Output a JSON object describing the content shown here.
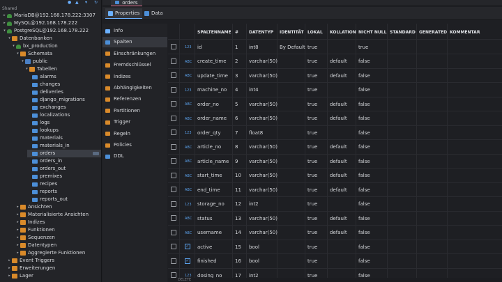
{
  "navigator": {
    "section_label": "Shared",
    "connections": [
      {
        "label": "MariaDB@192.168.178.222:3307"
      },
      {
        "label": "MySQL@192.168.178.222"
      },
      {
        "label": "PostgreSQL@192.168.178.222"
      }
    ],
    "tree": {
      "databases_label": "Datenbanken",
      "database_label": "bx_production",
      "schemata_label": "Schemata",
      "schema_label": "public",
      "tables_label": "Tabellen",
      "tables": [
        "alarms",
        "changes",
        "deliveries",
        "django_migrations",
        "exchanges",
        "localizations",
        "logs",
        "lookups",
        "materials",
        "materials_in",
        "orders",
        "orders_in",
        "orders_out",
        "premixes",
        "recipes",
        "reports",
        "reports_out"
      ],
      "selected_table": "orders",
      "schema_folders": [
        "Ansichten",
        "Materialisierte Ansichten",
        "Indizes",
        "Funktionen",
        "Sequenzen",
        "Datentypen",
        "Aggregierte Funktionen"
      ],
      "db_folders": [
        "Event Triggers",
        "Erweiterungen",
        "Lager"
      ]
    }
  },
  "editor": {
    "tab_label": "orders",
    "subtabs": [
      {
        "label": "Properties"
      },
      {
        "label": "Data"
      }
    ],
    "property_sections": [
      "Info",
      "Spalten",
      "Einschränkungen",
      "Fremdschlüssel",
      "Indizes",
      "Abhängigkeiten",
      "Referenzen",
      "Partitionen",
      "Trigger",
      "Regeln",
      "Policies",
      "DDL"
    ],
    "active_section": "Spalten",
    "columns_header": [
      "SPALTENNAME",
      "#",
      "DATENTYP",
      "IDENTITÄT",
      "LOKAL",
      "KOLLATION",
      "NICHT NULL",
      "STANDARD",
      "GENERATED",
      "KOMMENTAR"
    ],
    "rows": [
      {
        "type_icon": "123",
        "name": "id",
        "num": "1",
        "datatype": "int8",
        "identity": "By Default",
        "local": "true",
        "collation": "",
        "not_null": "true",
        "checkbox": false
      },
      {
        "type_icon": "ABC",
        "name": "create_time",
        "num": "2",
        "datatype": "varchar(50)",
        "identity": "",
        "local": "true",
        "collation": "default",
        "not_null": "false",
        "checkbox": false
      },
      {
        "type_icon": "ABC",
        "name": "update_time",
        "num": "3",
        "datatype": "varchar(50)",
        "identity": "",
        "local": "true",
        "collation": "default",
        "not_null": "false",
        "checkbox": false
      },
      {
        "type_icon": "123",
        "name": "machine_no",
        "num": "4",
        "datatype": "int4",
        "identity": "",
        "local": "true",
        "collation": "",
        "not_null": "false",
        "checkbox": false
      },
      {
        "type_icon": "ABC",
        "name": "order_no",
        "num": "5",
        "datatype": "varchar(50)",
        "identity": "",
        "local": "true",
        "collation": "default",
        "not_null": "false",
        "checkbox": false
      },
      {
        "type_icon": "ABC",
        "name": "order_name",
        "num": "6",
        "datatype": "varchar(50)",
        "identity": "",
        "local": "true",
        "collation": "default",
        "not_null": "false",
        "checkbox": false
      },
      {
        "type_icon": "123",
        "name": "order_qty",
        "num": "7",
        "datatype": "float8",
        "identity": "",
        "local": "true",
        "collation": "",
        "not_null": "false",
        "checkbox": false
      },
      {
        "type_icon": "ABC",
        "name": "article_no",
        "num": "8",
        "datatype": "varchar(50)",
        "identity": "",
        "local": "true",
        "collation": "default",
        "not_null": "false",
        "checkbox": false
      },
      {
        "type_icon": "ABC",
        "name": "article_name",
        "num": "9",
        "datatype": "varchar(50)",
        "identity": "",
        "local": "true",
        "collation": "default",
        "not_null": "false",
        "checkbox": false
      },
      {
        "type_icon": "ABC",
        "name": "start_time",
        "num": "10",
        "datatype": "varchar(50)",
        "identity": "",
        "local": "true",
        "collation": "default",
        "not_null": "false",
        "checkbox": false
      },
      {
        "type_icon": "ABC",
        "name": "end_time",
        "num": "11",
        "datatype": "varchar(50)",
        "identity": "",
        "local": "true",
        "collation": "default",
        "not_null": "false",
        "checkbox": false
      },
      {
        "type_icon": "123",
        "name": "storage_no",
        "num": "12",
        "datatype": "int2",
        "identity": "",
        "local": "true",
        "collation": "",
        "not_null": "false",
        "checkbox": false
      },
      {
        "type_icon": "ABC",
        "name": "status",
        "num": "13",
        "datatype": "varchar(50)",
        "identity": "",
        "local": "true",
        "collation": "default",
        "not_null": "false",
        "checkbox": false
      },
      {
        "type_icon": "ABC",
        "name": "username",
        "num": "14",
        "datatype": "varchar(50)",
        "identity": "",
        "local": "true",
        "collation": "default",
        "not_null": "false",
        "checkbox": false
      },
      {
        "type_icon": "check",
        "name": "active",
        "num": "15",
        "datatype": "bool",
        "identity": "",
        "local": "true",
        "collation": "",
        "not_null": "false",
        "checkbox": false
      },
      {
        "type_icon": "check",
        "name": "finished",
        "num": "16",
        "datatype": "bool",
        "identity": "",
        "local": "true",
        "collation": "",
        "not_null": "false",
        "checkbox": false
      },
      {
        "type_icon": "123",
        "name": "dosing_no",
        "num": "17",
        "datatype": "int2",
        "identity": "",
        "local": "true",
        "collation": "",
        "not_null": "false",
        "checkbox": false
      }
    ],
    "footer_action": "DELETE"
  },
  "colors": {
    "accent": "#6bb0ff",
    "folder": "#d98a2a",
    "table_icon": "#4c8fd8",
    "db_icon": "#3f8f3f",
    "tab_underline": "#e06b8a"
  }
}
